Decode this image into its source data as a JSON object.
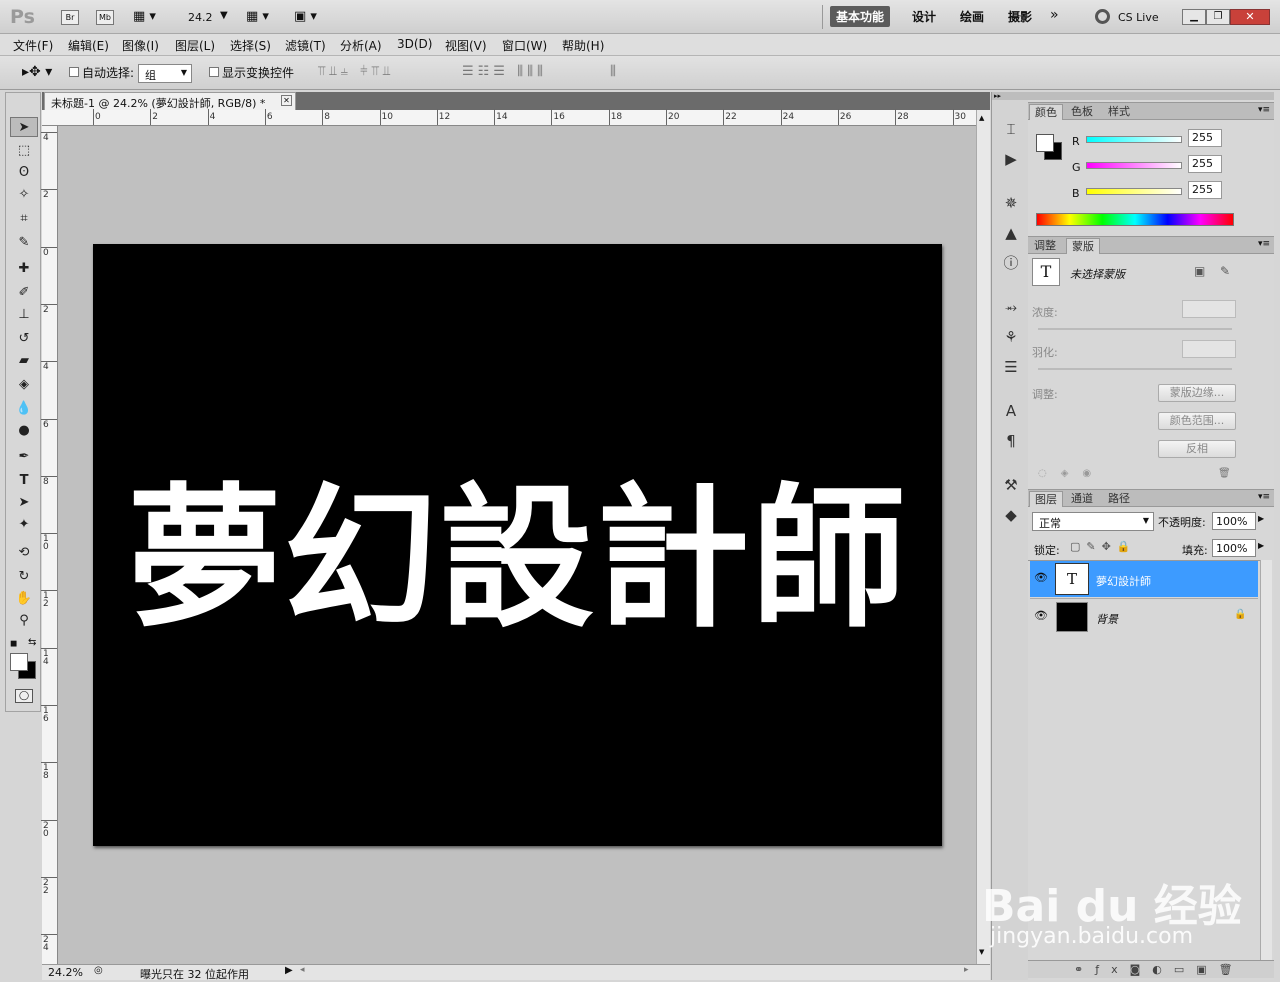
{
  "app": {
    "logo": "Ps",
    "br": "Br",
    "mb": "Mb",
    "zoom": "24.2"
  },
  "workspaces": [
    "基本功能",
    "设计",
    "绘画",
    "摄影"
  ],
  "cslive": "CS Live",
  "menu": [
    "文件(F)",
    "编辑(E)",
    "图像(I)",
    "图层(L)",
    "选择(S)",
    "滤镜(T)",
    "分析(A)",
    "3D(D)",
    "视图(V)",
    "窗口(W)",
    "帮助(H)"
  ],
  "options": {
    "auto_select": "自动选择:",
    "auto_select_value": "组",
    "show_transform": "显示变换控件"
  },
  "document": {
    "tab_title": "未标题-1 @ 24.2% (夢幻設計師, RGB/8) *",
    "text": "夢幻設計師"
  },
  "ruler": {
    "h_ticks": [
      "0",
      "2",
      "4",
      "6",
      "8",
      "10",
      "12",
      "14",
      "16",
      "18",
      "20",
      "22",
      "24",
      "26",
      "28",
      "30"
    ],
    "v_ticks": [
      "4",
      "2",
      "0",
      "2",
      "4",
      "6",
      "8",
      "1 0",
      "1 2",
      "1 4",
      "1 6",
      "1 8",
      "2 0",
      "2 2",
      "2 4"
    ]
  },
  "status": {
    "zoom": "24.2%",
    "message": "曝光只在 32 位起作用"
  },
  "color_panel": {
    "tabs": [
      "颜色",
      "色板",
      "样式"
    ],
    "channels": [
      {
        "label": "R",
        "value": "255",
        "color": "#00ffff"
      },
      {
        "label": "G",
        "value": "255",
        "color": "#ff00ff"
      },
      {
        "label": "B",
        "value": "255",
        "color": "#ffff00"
      }
    ]
  },
  "mask_panel": {
    "tabs": [
      "调整",
      "蒙版"
    ],
    "title": "未选择蒙版",
    "density": "浓度:",
    "feather": "羽化:",
    "refine": "调整:",
    "buttons": [
      "蒙版边缘...",
      "颜色范围...",
      "反相"
    ]
  },
  "layers_panel": {
    "tabs": [
      "图层",
      "通道",
      "路径"
    ],
    "blend_mode": "正常",
    "opacity_label": "不透明度:",
    "opacity": "100%",
    "lock_label": "锁定:",
    "fill_label": "填充:",
    "fill": "100%",
    "layers": [
      {
        "name": "夢幻設計師",
        "type": "text",
        "selected": true
      },
      {
        "name": "背景",
        "type": "background",
        "selected": false
      }
    ]
  },
  "watermark": {
    "brand": "Bai du 经验",
    "url": "jingyan.baidu.com"
  }
}
